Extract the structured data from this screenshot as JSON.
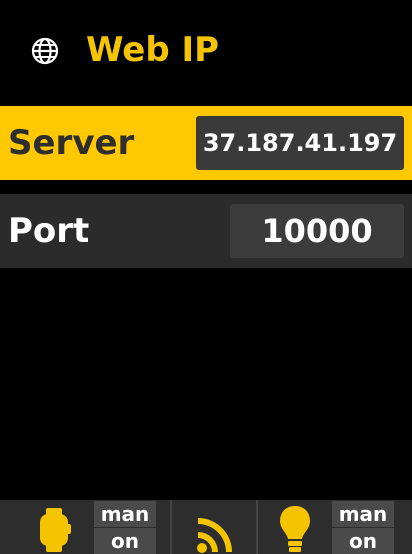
{
  "header": {
    "title": "Web IP",
    "icon": "globe-icon",
    "accent": "#f5c400"
  },
  "fields": {
    "server": {
      "label": "Server",
      "value": "37.187.41.197"
    },
    "port": {
      "label": "Port",
      "value": "10000"
    }
  },
  "footer": {
    "left": {
      "icon": "watch-icon",
      "mode": "man",
      "state": "on"
    },
    "middle": {
      "icon": "rss-wifi-icon"
    },
    "right": {
      "icon": "lightbulb-icon",
      "mode": "man",
      "state": "on"
    }
  }
}
